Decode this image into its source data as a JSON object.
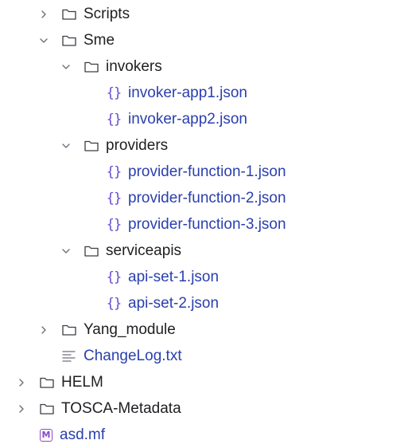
{
  "tree": {
    "scripts": "Scripts",
    "sme": "Sme",
    "invokers": "invokers",
    "invoker_app1": "invoker-app1.json",
    "invoker_app2": "invoker-app2.json",
    "providers": "providers",
    "provider_function_1": "provider-function-1.json",
    "provider_function_2": "provider-function-2.json",
    "provider_function_3": "provider-function-3.json",
    "serviceapis": "serviceapis",
    "api_set_1": "api-set-1.json",
    "api_set_2": "api-set-2.json",
    "yang_module": "Yang_module",
    "changelog": "ChangeLog.txt",
    "helm": "HELM",
    "tosca_metadata": "TOSCA-Metadata",
    "asd_mf": "asd.mf"
  },
  "icons": {
    "json_glyph": "{}",
    "manifest_glyph": "M"
  },
  "colors": {
    "file_text": "#2a3fae",
    "json_icon": "#6a4ad0",
    "manifest_icon": "#8a49c8",
    "chevron": "#6c707e"
  }
}
